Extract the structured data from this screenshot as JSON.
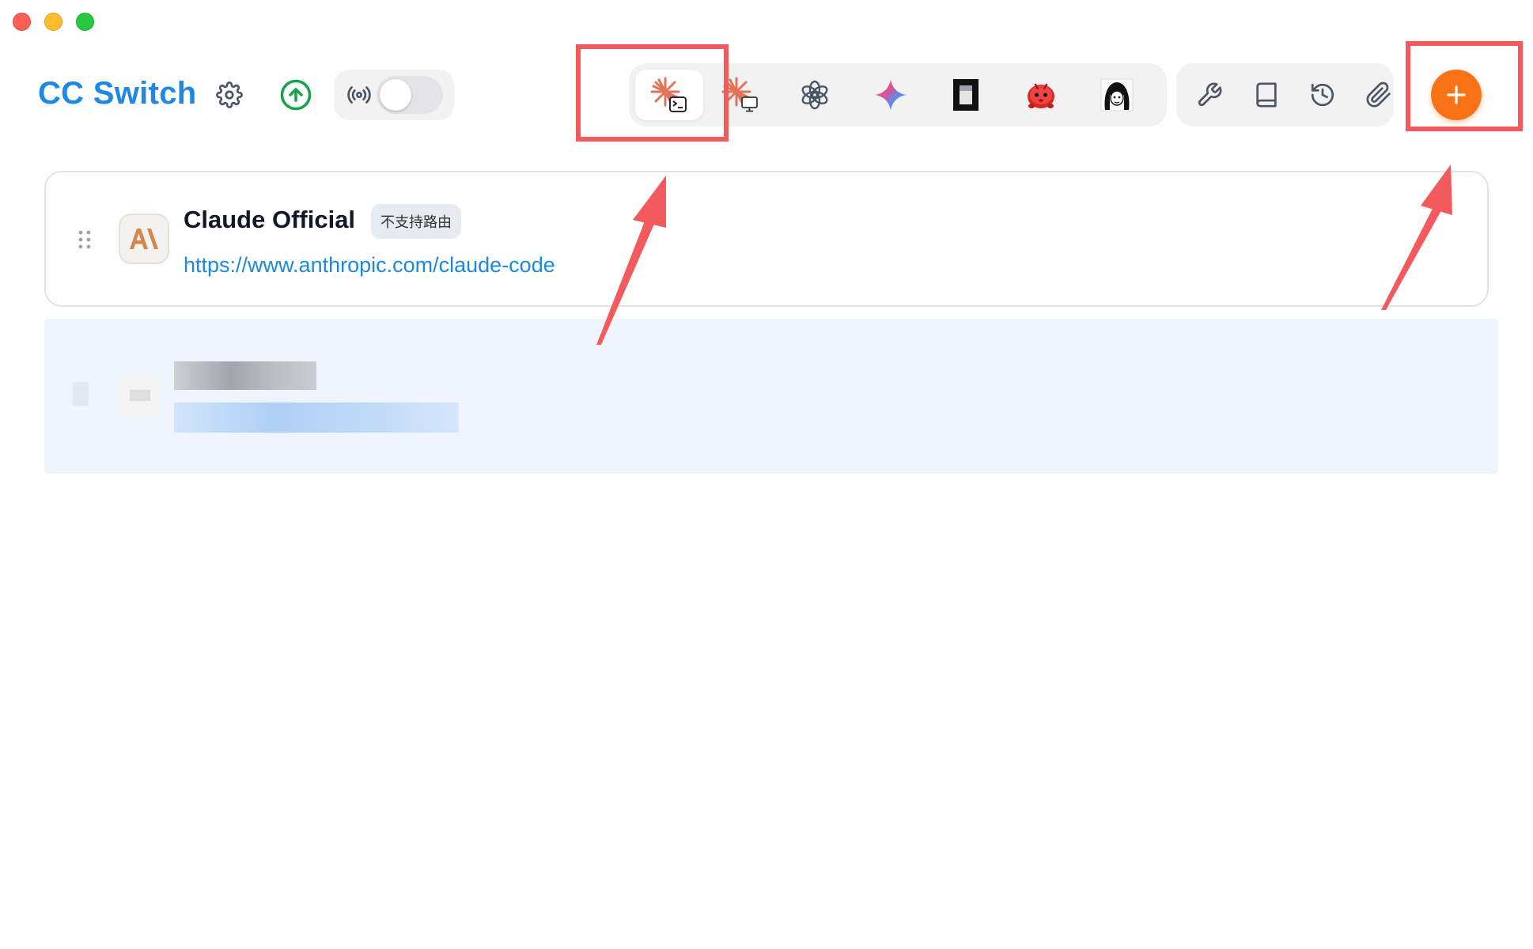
{
  "window": {
    "controls": [
      "close",
      "minimize",
      "zoom"
    ]
  },
  "header": {
    "title": "CC Switch",
    "settings_icon": "gear-icon",
    "update_icon": "arrow-up-circle-icon",
    "proxy": {
      "icon": "broadcast-icon",
      "enabled": false
    }
  },
  "app_tabs": [
    {
      "name": "claude-code",
      "icon": "claude-terminal-icon",
      "active": true
    },
    {
      "name": "claude-desktop",
      "icon": "claude-desktop-icon",
      "active": false
    },
    {
      "name": "openai",
      "icon": "openai-icon",
      "active": false
    },
    {
      "name": "gemini",
      "icon": "gemini-icon",
      "active": false
    },
    {
      "name": "app-4",
      "icon": "dark-window-icon",
      "active": false
    },
    {
      "name": "app-5",
      "icon": "red-mascot-icon",
      "active": false
    },
    {
      "name": "app-6",
      "icon": "anime-avatar-icon",
      "active": false
    }
  ],
  "tools": [
    {
      "name": "wrench",
      "icon": "wrench-icon"
    },
    {
      "name": "book",
      "icon": "book-icon"
    },
    {
      "name": "history",
      "icon": "history-icon"
    },
    {
      "name": "paperclip",
      "icon": "paperclip-icon"
    }
  ],
  "add_button": {
    "icon": "plus-icon"
  },
  "providers": [
    {
      "name": "Claude Official",
      "badge": "不支持路由",
      "url": "https://www.anthropic.com/claude-code",
      "logo_text": "A\\"
    }
  ],
  "colors": {
    "accent_blue": "#1e88e5",
    "add_orange": "#f97316",
    "annotation_red": "#f25a5e",
    "claude_orange": "#e0735a"
  }
}
